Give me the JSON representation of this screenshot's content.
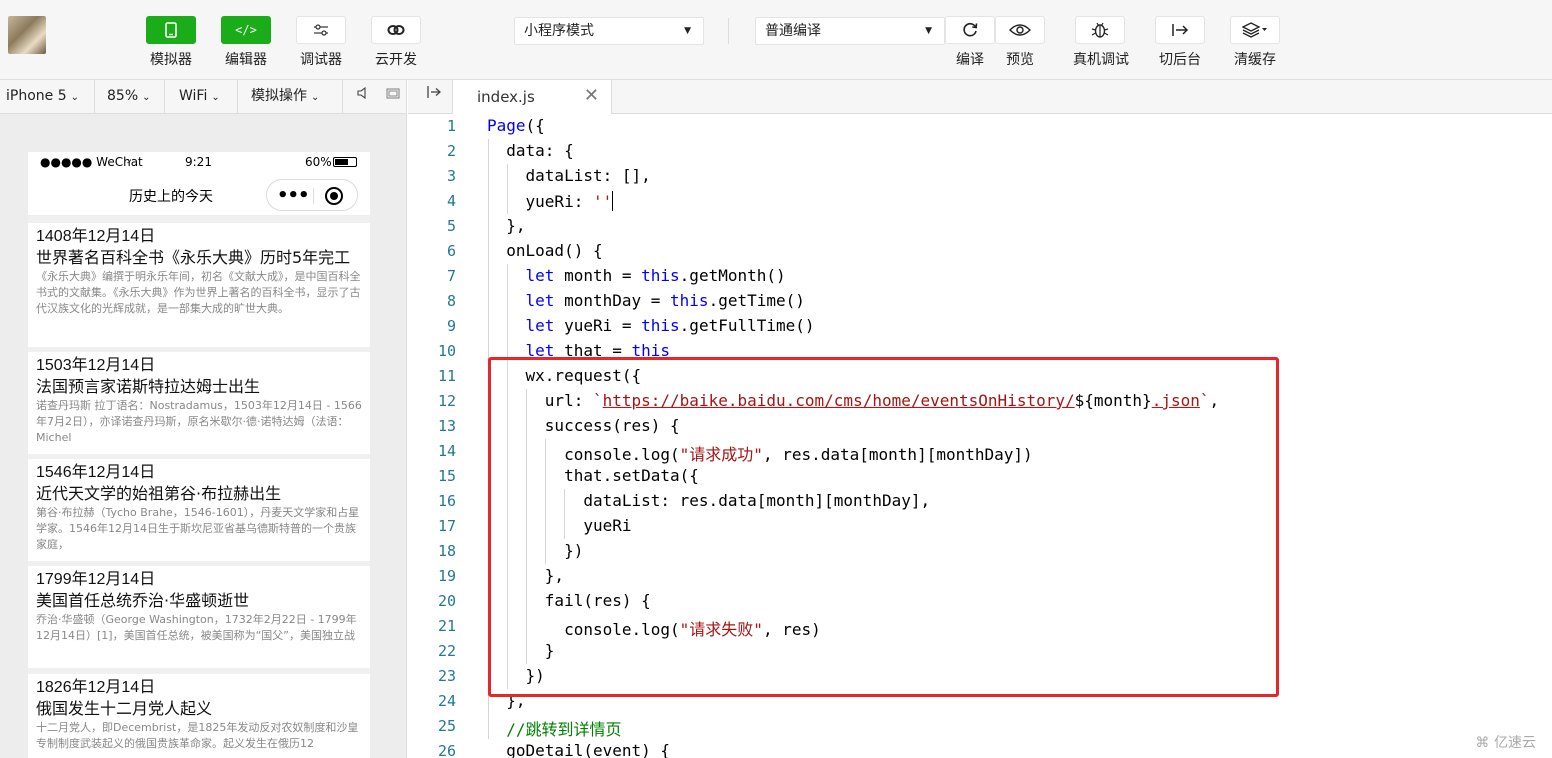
{
  "toolbar": {
    "tools_left": [
      {
        "label": "模拟器",
        "icon": "phone-icon"
      },
      {
        "label": "编辑器",
        "icon": "code-icon"
      },
      {
        "label": "调试器",
        "icon": "debug-sliders-icon"
      },
      {
        "label": "云开发",
        "icon": "cloud-link-icon"
      }
    ],
    "mode_select": "小程序模式",
    "compile_select": "普通编译",
    "tools_right": [
      {
        "label": "编译",
        "icon": "refresh-icon"
      },
      {
        "label": "预览",
        "icon": "eye-icon"
      },
      {
        "label": "真机调试",
        "icon": "bug-icon"
      },
      {
        "label": "切后台",
        "icon": "switch-background-icon"
      },
      {
        "label": "清缓存",
        "icon": "layers-icon"
      }
    ]
  },
  "simulator_bar": {
    "device": "iPhone 5",
    "zoom": "85%",
    "network": "WiFi",
    "simulate": "模拟操作"
  },
  "phone": {
    "status": {
      "carrier": "●●●●● WeChat",
      "time": "9:21",
      "battery": "60%"
    },
    "nav_title": "历史上的今天",
    "items": [
      {
        "date": "1408年12月14日",
        "title": "世界著名百科全书《永乐大典》历时5年完工",
        "desc": "《永乐大典》编撰于明永乐年间，初名《文献大成》，是中国百科全书式的文献集。《永乐大典》作为世界上著名的百科全书，显示了古代汉族文化的光辉成就，是一部集大成的旷世大典。"
      },
      {
        "date": "1503年12月14日",
        "title": "法国预言家诺斯特拉达姆士出生",
        "desc": "诺查丹玛斯 拉丁语名：Nostradamus，1503年12月14日 - 1566年7月2日），亦译诺查丹玛斯，原名米歇尔·德·诺特达姆（法语：Michel"
      },
      {
        "date": "1546年12月14日",
        "title": "近代天文学的始祖第谷·布拉赫出生",
        "desc": "第谷·布拉赫（Tycho Brahe，1546-1601），丹麦天文学家和占星学家。1546年12月14日生于斯坎尼亚省基乌德斯特普的一个贵族家庭，"
      },
      {
        "date": "1799年12月14日",
        "title": "美国首任总统乔治·华盛顿逝世",
        "desc": "乔治·华盛顿（George Washington，1732年2月22日 - 1799年12月14日）[1]，美国首任总统，被美国称为“国父”，美国独立战"
      },
      {
        "date": "1826年12月14日",
        "title": "俄国发生十二月党人起义",
        "desc": "十二月党人，即Decembrist，是1825年发动反对农奴制度和沙皇专制制度武装起义的俄国贵族革命家。起义发生在俄历12"
      }
    ]
  },
  "editor": {
    "tab": "index.js",
    "line_numbers": [
      "1",
      "2",
      "3",
      "4",
      "5",
      "6",
      "7",
      "8",
      "9",
      "10",
      "11",
      "12",
      "13",
      "14",
      "15",
      "16",
      "17",
      "18",
      "19",
      "20",
      "21",
      "22",
      "23",
      "24",
      "25",
      "26"
    ]
  },
  "watermark": "亿速云"
}
